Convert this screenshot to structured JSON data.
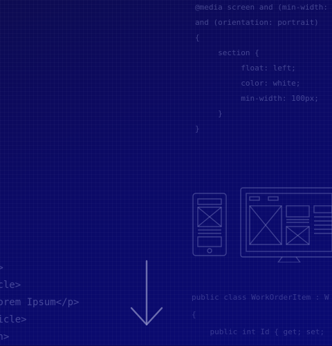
{
  "background": {
    "color_top": "#0d0b52",
    "color_bottom": "#090a73"
  },
  "code_top_right": [
    {
      "indent": "",
      "text": "@media screen and (min-width:"
    },
    {
      "indent": "",
      "text": "and (orientation: portrait)"
    },
    {
      "indent": "",
      "text": "{"
    },
    {
      "indent": "     ",
      "text": "section {"
    },
    {
      "indent": "          ",
      "text": "float: left;"
    },
    {
      "indent": "          ",
      "text": "color: white;"
    },
    {
      "indent": "          ",
      "text": "min-width: 100px;"
    },
    {
      "indent": "     ",
      "text": "}"
    },
    {
      "indent": "",
      "text": "}"
    }
  ],
  "code_bottom_left": [
    "n>",
    "icle>",
    "Lorem Ipsum</p>",
    "ticle>",
    "on>"
  ],
  "code_bottom_right": [
    {
      "indent": "",
      "text": "public class WorkOrderItem : W"
    },
    {
      "indent": "",
      "text": "{"
    },
    {
      "indent": "    ",
      "text": "public int Id { get; set;"
    }
  ],
  "icons": {
    "wireframe": "responsive-wireframe-icon",
    "arrow": "scroll-down-arrow-icon"
  },
  "colors": {
    "arrow": "#8e8fc6",
    "code": "#8c91d2",
    "wireframe": "#7d80c0"
  }
}
